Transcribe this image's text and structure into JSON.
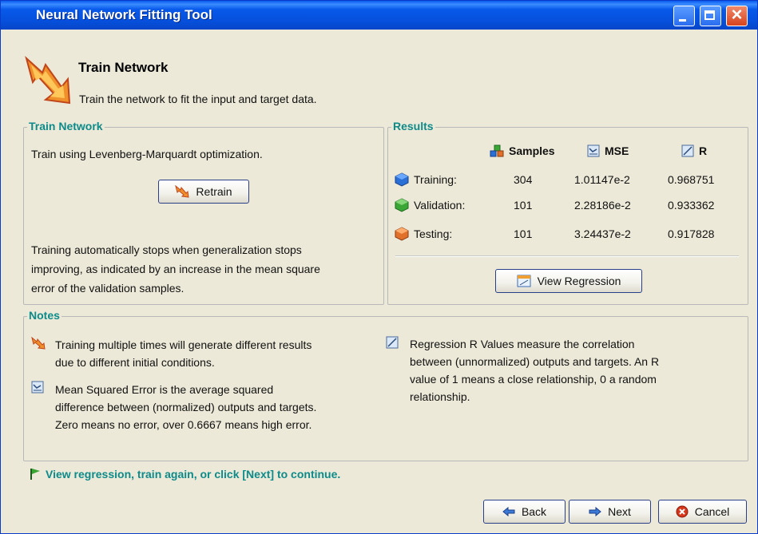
{
  "window": {
    "title": "Neural Network Fitting Tool"
  },
  "header": {
    "title": "Train Network",
    "subtitle": "Train the network to fit the input and target data."
  },
  "train_panel": {
    "legend": "Train Network",
    "method": "Train using Levenberg-Marquardt optimization.",
    "retrain_label": "Retrain",
    "description": [
      "Training automatically stops when generalization stops",
      "improving, as indicated by an increase in the mean square",
      "error of the validation samples."
    ]
  },
  "results": {
    "legend": "Results",
    "columns": {
      "samples": "Samples",
      "mse": "MSE",
      "r": "R"
    },
    "rows": [
      {
        "label": "Training:",
        "samples": "304",
        "mse": "1.01147e-2",
        "r": "0.968751",
        "color": "#2a6fd6"
      },
      {
        "label": "Validation:",
        "samples": "101",
        "mse": "2.28186e-2",
        "r": "0.933362",
        "color": "#3aa636"
      },
      {
        "label": "Testing:",
        "samples": "101",
        "mse": "3.24437e-2",
        "r": "0.917828",
        "color": "#e0702a"
      }
    ],
    "view_regression_label": "View Regression"
  },
  "notes": {
    "legend": "Notes",
    "left": [
      {
        "icon": "train-icon",
        "lines": [
          "Training multiple times will generate different results",
          "due to different initial conditions."
        ]
      },
      {
        "icon": "mse-icon",
        "lines": [
          "Mean Squared Error is the average squared",
          "difference between (normalized) outputs and targets.",
          "Zero means no error, over 0.6667 means high error."
        ]
      }
    ],
    "right": [
      {
        "icon": "regression-icon",
        "lines": [
          "Regression R Values measure the correlation",
          "between (unnormalized) outputs and targets. An R",
          "value of 1 means a close relationship, 0 a random",
          "relationship."
        ]
      }
    ]
  },
  "footer": {
    "message": "View regression, train again, or click [Next] to continue.",
    "back_label": "Back",
    "next_label": "Next",
    "cancel_label": "Cancel"
  },
  "colors": {
    "accent_teal": "#0d8a8a",
    "title_blue": "#0650dc"
  }
}
